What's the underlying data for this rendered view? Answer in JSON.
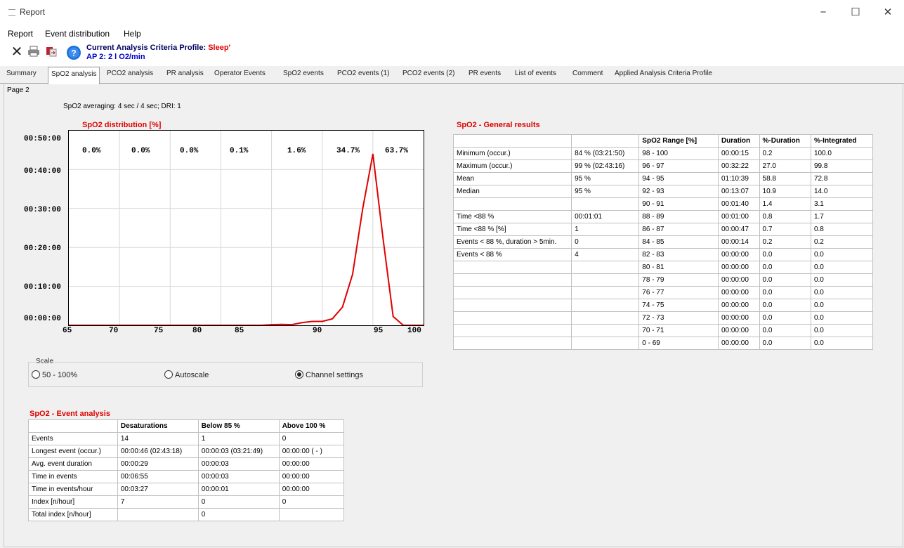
{
  "window": {
    "title": "Report",
    "minimize": "−",
    "maximize": "☐",
    "close": "✕"
  },
  "menu": [
    "Report",
    "Event distribution",
    "Help"
  ],
  "toolbar": {
    "profile_label": "Current Analysis Criteria Profile:",
    "profile_name": "Sleep'",
    "profile_line2": "AP 2: 2 l O2/min",
    "icons": [
      "close-icon",
      "print-icon",
      "export-icon",
      "help-icon"
    ]
  },
  "tabs": [
    "Summary",
    "SpO2 analysis",
    "PCO2 analysis",
    "PR analysis",
    "Operator Events",
    "SpO2 events",
    "PCO2 events (1)",
    "PCO2 events (2)",
    "PR events",
    "List of events",
    "Comment",
    "Applied Analysis Criteria Profile"
  ],
  "active_tab": 1,
  "page_label": "Page 2",
  "averaging": "SpO2 averaging: 4 sec / 4 sec;  DRI: 1",
  "distribution": {
    "title": "SpO2 distribution [%]",
    "y_ticks": [
      "00:50:00",
      "00:40:00",
      "00:30:00",
      "00:20:00",
      "00:10:00",
      "00:00:00"
    ],
    "x_ticks": [
      "65",
      "70",
      "75",
      "80",
      "85",
      "90",
      "95",
      "100"
    ],
    "percentages": [
      "0.0%",
      "0.0%",
      "0.0%",
      "0.1%",
      "1.6%",
      "34.7%",
      "63.7%"
    ]
  },
  "chart_data": {
    "type": "line",
    "title": "SpO2 distribution [%]",
    "xlabel": "",
    "ylabel": "",
    "xlim": [
      65,
      100
    ],
    "ylim": [
      0,
      3000
    ],
    "y_unit": "seconds (shown as hh:mm:ss)",
    "x": [
      65,
      84,
      85,
      86,
      87,
      88,
      89,
      90,
      91,
      92,
      93,
      94,
      95,
      96,
      97,
      98,
      99,
      100
    ],
    "y": [
      0,
      0,
      10,
      14,
      10,
      40,
      60,
      60,
      100,
      280,
      787,
      1800,
      2640,
      1340,
      135,
      0,
      0,
      0
    ],
    "bin_percentages": [
      "0.0%",
      "0.0%",
      "0.0%",
      "0.1%",
      "1.6%",
      "34.7%",
      "63.7%"
    ],
    "grid": true,
    "color": "#e00000"
  },
  "scale": {
    "label": "Scale",
    "options": [
      "50 - 100%",
      "Autoscale",
      "Channel settings"
    ],
    "selected": 2
  },
  "general": {
    "title": "SpO2 - General results",
    "headers": [
      "",
      "",
      "SpO2 Range [%]",
      "Duration",
      "%-Duration",
      "%-Integrated"
    ],
    "rows": [
      [
        "Minimum (occur.)",
        "84 % (03:21:50)",
        "98 - 100",
        "00:00:15",
        "0.2",
        "100.0"
      ],
      [
        "Maximum (occur.)",
        "99 % (02:43:16)",
        "96 - 97",
        "00:32:22",
        "27.0",
        "99.8"
      ],
      [
        "Mean",
        "95 %",
        "94 - 95",
        "01:10:39",
        "58.8",
        "72.8"
      ],
      [
        "Median",
        "95 %",
        "92 - 93",
        "00:13:07",
        "10.9",
        "14.0"
      ],
      [
        "",
        "",
        "90 - 91",
        "00:01:40",
        "1.4",
        "3.1"
      ],
      [
        "Time <88 %",
        "00:01:01",
        "88 - 89",
        "00:01:00",
        "0.8",
        "1.7"
      ],
      [
        "Time <88 % [%]",
        "1",
        "86 - 87",
        "00:00:47",
        "0.7",
        "0.8"
      ],
      [
        "Events < 88 %, duration > 5min.",
        "0",
        "84 - 85",
        "00:00:14",
        "0.2",
        "0.2"
      ],
      [
        "Events < 88 %",
        "4",
        "82 - 83",
        "00:00:00",
        "0.0",
        "0.0"
      ],
      [
        "",
        "",
        "80 - 81",
        "00:00:00",
        "0.0",
        "0.0"
      ],
      [
        "",
        "",
        "78 - 79",
        "00:00:00",
        "0.0",
        "0.0"
      ],
      [
        "",
        "",
        "76 - 77",
        "00:00:00",
        "0.0",
        "0.0"
      ],
      [
        "",
        "",
        "74 - 75",
        "00:00:00",
        "0.0",
        "0.0"
      ],
      [
        "",
        "",
        "72 - 73",
        "00:00:00",
        "0.0",
        "0.0"
      ],
      [
        "",
        "",
        "70 - 71",
        "00:00:00",
        "0.0",
        "0.0"
      ],
      [
        "",
        "",
        "0 - 69",
        "00:00:00",
        "0.0",
        "0.0"
      ]
    ]
  },
  "events": {
    "title": "SpO2 - Event analysis",
    "headers": [
      "",
      "Desaturations",
      "Below 85 %",
      "Above 100 %"
    ],
    "rows": [
      [
        "Events",
        "14",
        "1",
        "0"
      ],
      [
        "Longest event (occur.)",
        "00:00:46  (02:43:18)",
        "00:00:03  (03:21:49)",
        "00:00:00  ( - )"
      ],
      [
        "Avg. event duration",
        "00:00:29",
        "00:00:03",
        "00:00:00"
      ],
      [
        "Time in events",
        "00:06:55",
        "00:00:03",
        "00:00:00"
      ],
      [
        "Time in events/hour",
        "00:03:27",
        "00:00:01",
        "00:00:00"
      ],
      [
        "Index [n/hour]",
        "7",
        "0",
        "0"
      ],
      [
        "Total index [n/hour]",
        "",
        "0",
        ""
      ]
    ]
  }
}
